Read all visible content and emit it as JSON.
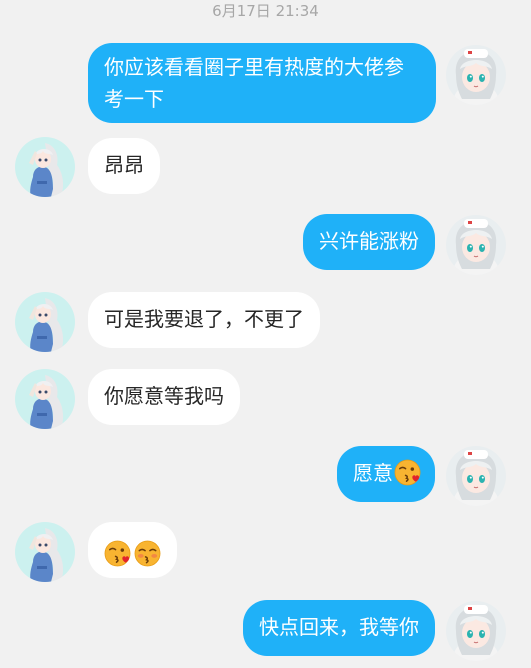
{
  "chat": {
    "timestamp": "6月17日 21:34",
    "messages": [
      {
        "side": "out",
        "text": "你应该看看圈子里有热度的大佬参考一下"
      },
      {
        "side": "in",
        "text": "昂昂"
      },
      {
        "side": "out",
        "text": "兴许能涨粉"
      },
      {
        "side": "in",
        "text": "可是我要退了，不更了"
      },
      {
        "side": "in",
        "text": "你愿意等我吗"
      },
      {
        "side": "out",
        "text": "愿意",
        "emoji": [
          "kissing-heart-emoji"
        ]
      },
      {
        "side": "in",
        "text": "",
        "emoji": [
          "kissing-heart-emoji",
          "kissing-closed-eyes-emoji"
        ]
      },
      {
        "side": "out",
        "text": "快点回来，我等你"
      }
    ]
  },
  "colors": {
    "background": "#f1f1f1",
    "outgoing_bubble": "#1fb1f8",
    "incoming_bubble": "#ffffff",
    "timestamp_text": "#a7a7a7",
    "incoming_text": "#262626"
  }
}
